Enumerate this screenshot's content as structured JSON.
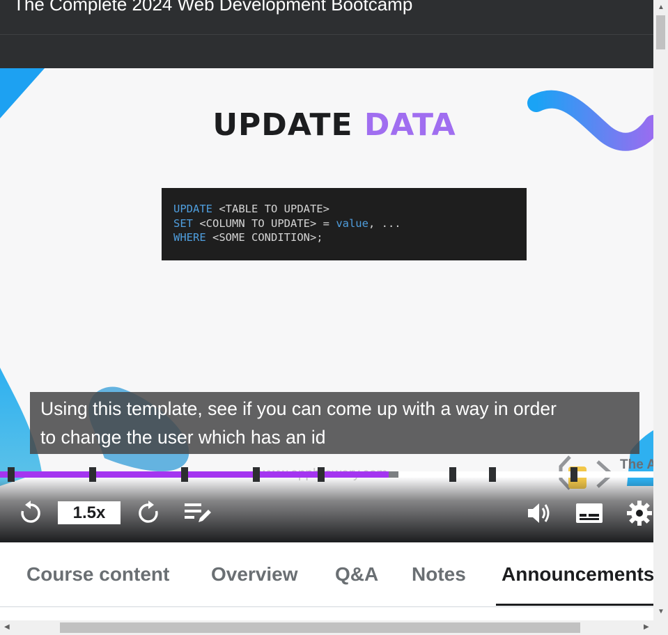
{
  "header": {
    "course_title": "The Complete 2024 Web Development Bootcamp"
  },
  "slide": {
    "title_main": "UPDATE",
    "title_accent": "DATA",
    "code": [
      [
        {
          "t": "UPDATE",
          "k": true
        },
        {
          "t": " <TABLE TO UPDATE>",
          "k": false
        }
      ],
      [
        {
          "t": "SET",
          "k": true
        },
        {
          "t": " <COLUMN TO UPDATE> = ",
          "k": false
        },
        {
          "t": "value",
          "k": true
        },
        {
          "t": ", ...",
          "k": false
        }
      ],
      [
        {
          "t": "WHERE",
          "k": true
        },
        {
          "t": " <SOME CONDITION>;",
          "k": false
        }
      ]
    ],
    "watermark": "www.appbrewery.com",
    "brand": "The App"
  },
  "caption": {
    "line1": "Using this template, see if you can come up with a way in order",
    "line2": "to change the user which has an id"
  },
  "player": {
    "progress_fraction": 0.595,
    "buffered_fraction": 0.61,
    "speed_label": "1.5x",
    "chapter_markers": [
      16,
      133,
      265,
      368,
      461,
      650,
      707,
      824
    ]
  },
  "tabs": [
    {
      "label": "Course content",
      "active": false
    },
    {
      "label": "Overview",
      "active": false
    },
    {
      "label": "Q&A",
      "active": false
    },
    {
      "label": "Notes",
      "active": false
    },
    {
      "label": "Announcements",
      "active": true
    }
  ],
  "colors": {
    "accent": "#a435f0",
    "dark": "#2d2f31",
    "keyword": "#4f9ede"
  }
}
